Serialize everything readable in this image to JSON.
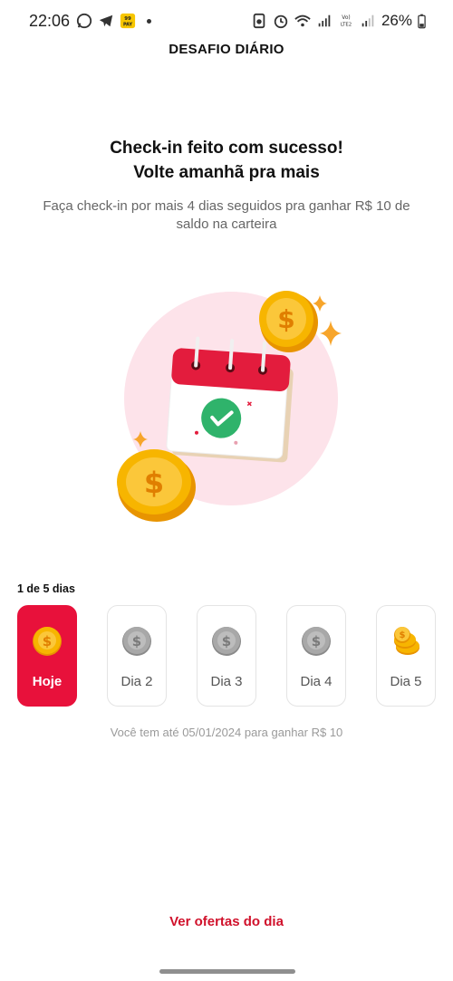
{
  "status_bar": {
    "time": "22:06",
    "icons_left": [
      "whatsapp-icon",
      "telegram-icon",
      "pay-icon"
    ],
    "pay_label": "99\nPAY",
    "network_label": "Vo)\nLTE2",
    "battery": "26%"
  },
  "header": {
    "title": "DESAFIO DIÁRIO"
  },
  "main": {
    "headline_line1": "Check-in feito com sucesso!",
    "headline_line2": "Volte amanhã pra mais",
    "subtext": "Faça check-in por mais 4 dias seguidos pra ganhar R$ 10 de saldo na carteira"
  },
  "progress": {
    "label": "1 de 5 dias",
    "days_completed": 1,
    "days_total": 5,
    "days": [
      {
        "label": "Hoje",
        "state": "today",
        "icon": "gold-coin-icon"
      },
      {
        "label": "Dia 2",
        "state": "locked",
        "icon": "grey-coin-icon"
      },
      {
        "label": "Dia 3",
        "state": "locked",
        "icon": "grey-coin-icon"
      },
      {
        "label": "Dia 4",
        "state": "locked",
        "icon": "grey-coin-icon"
      },
      {
        "label": "Dia 5",
        "state": "reward",
        "icon": "coin-stack-icon"
      }
    ],
    "deadline": "Você tem até 05/01/2024 para ganhar R$ 10"
  },
  "cta": {
    "label": "Ver ofertas do dia"
  },
  "colors": {
    "accent": "#e8113b",
    "link": "#d0112b",
    "coin": "#f7b500",
    "check": "#2fb36b"
  }
}
